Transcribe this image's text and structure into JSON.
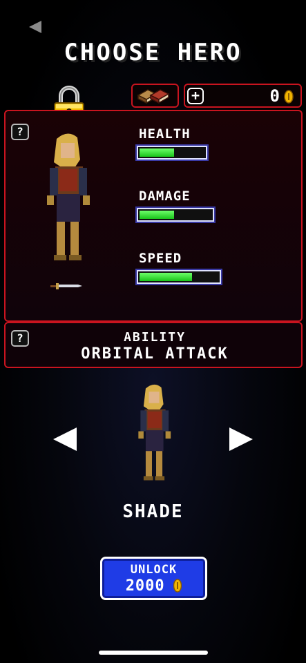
{
  "header": {
    "title": "CHOOSE HERO"
  },
  "currency": {
    "coins": "0",
    "add_label": "+"
  },
  "stats": [
    {
      "label": "HEALTH",
      "value": 0.55
    },
    {
      "label": "DAMAGE",
      "value": 0.5
    },
    {
      "label": "SPEED",
      "value": 0.68
    }
  ],
  "help_label": "?",
  "ability": {
    "label": "ABILITY",
    "name": "ORBITAL ATTACK"
  },
  "hero": {
    "name": "SHADE",
    "locked": true
  },
  "unlock": {
    "label": "UNLOCK",
    "price": "2000"
  },
  "colors": {
    "panel_border": "#c9141f",
    "bar_fill": "#2fdc2f",
    "unlock_bg": "#1f3ce6",
    "coin": "#f0b400"
  }
}
